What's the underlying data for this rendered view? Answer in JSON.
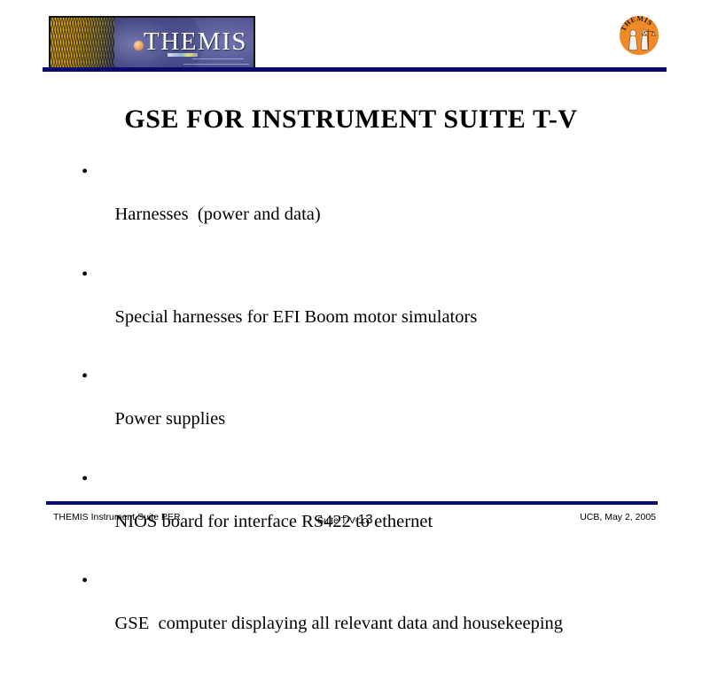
{
  "slide": {
    "title": "GSE FOR INSTRUMENT SUITE T-V",
    "background_color": "#ffffff",
    "accent_color": "#0a0a6e"
  },
  "header": {
    "banner_logo": {
      "icon": "themis-magnetosphere-logo",
      "wordmark": "THEMIS"
    },
    "seal": {
      "icon": "themis-goddess-seal-icon",
      "ring_text": "THEMIS",
      "seal_color": "#f08a28"
    }
  },
  "body": {
    "bullet_glyph": "•",
    "bullets": [
      "Harnesses  (power and data)",
      "Special harnesses for EFI Boom motor simulators",
      "Power supplies",
      "NIOS board for interface RS422 to ethernet",
      "GSE  computer displaying all relevant data and housekeeping"
    ]
  },
  "footer": {
    "left": "THEMIS Instrument Suite PER",
    "center_prefix": "Suite T-V-",
    "page_number": "13",
    "right": "UCB, May 2, 2005"
  }
}
